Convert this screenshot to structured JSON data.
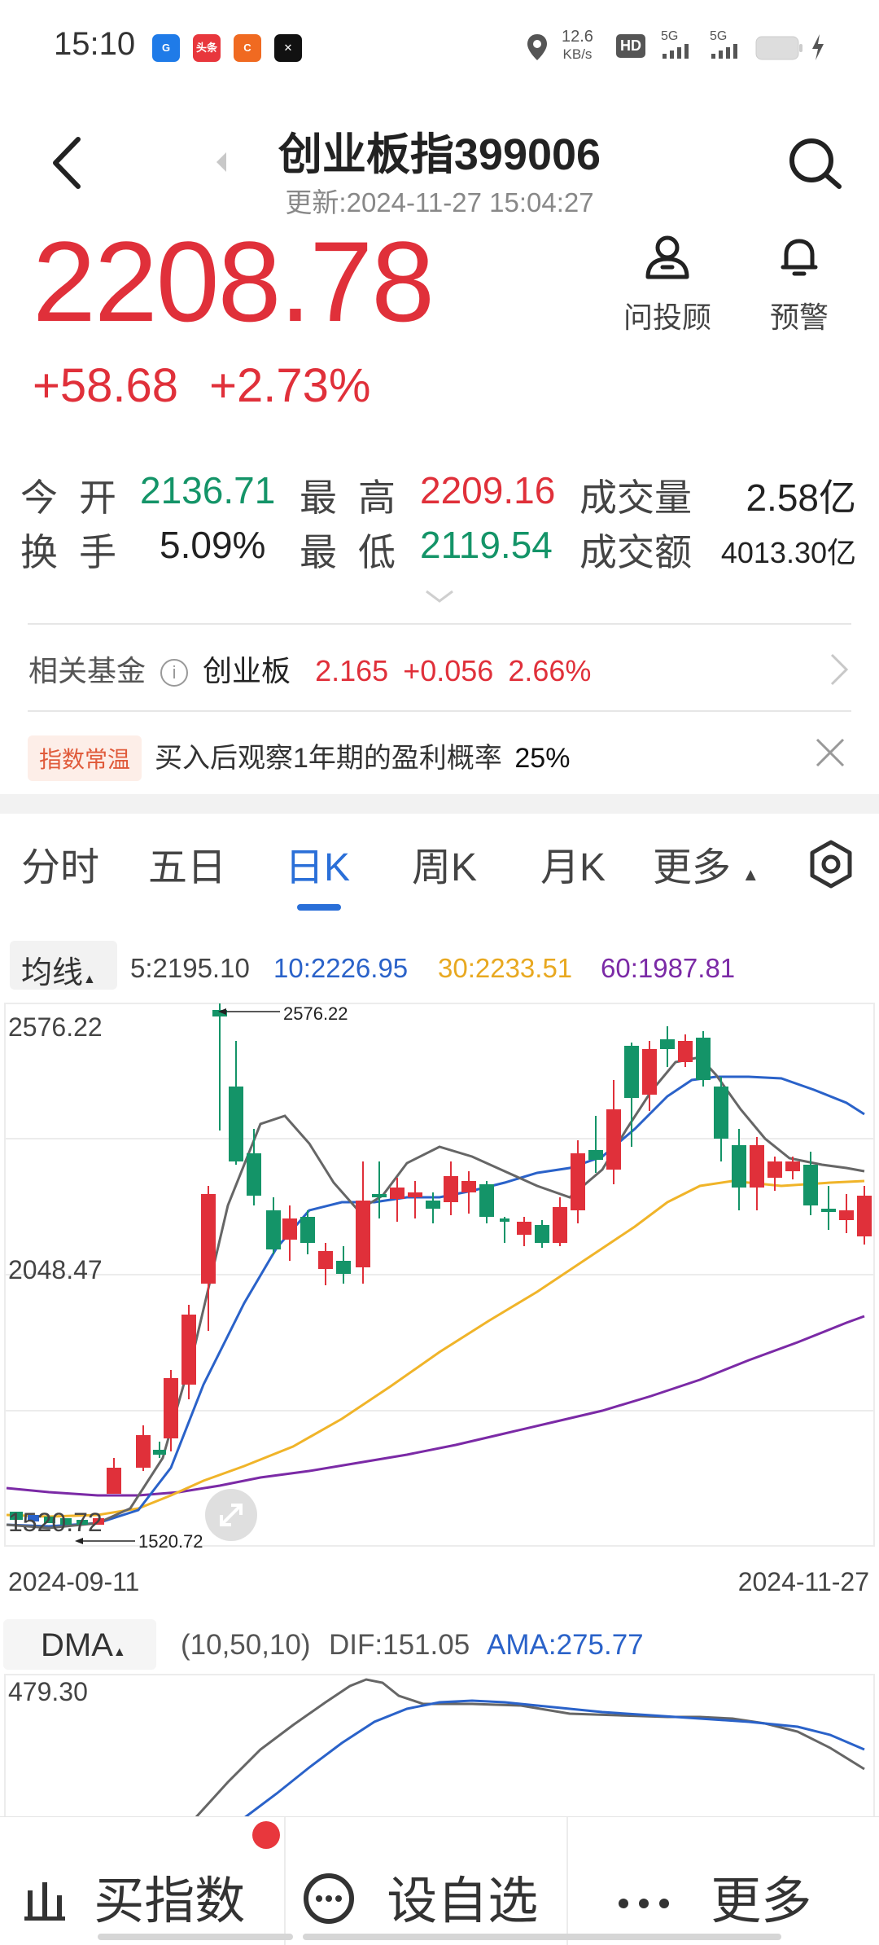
{
  "status_bar": {
    "time": "15:10",
    "net_speed_value": "12.6",
    "net_speed_unit": "KB/s",
    "hd_label": "HD",
    "sim1": "5G",
    "sim2": "5G",
    "icons": [
      "app-icon-blue",
      "app-icon-toutiao",
      "app-icon-orange",
      "app-icon-capcut",
      "location-icon",
      "signal-icon",
      "battery-icon",
      "charging-icon"
    ],
    "app_icon_toutiao_text": "头条"
  },
  "header": {
    "title": "创业板指399006",
    "updated": "更新:2024-11-27 15:04:27"
  },
  "quote": {
    "price": "2208.78",
    "change": "+58.68",
    "change_pct": "+2.73%",
    "advisor_label": "问投顾",
    "alert_label": "预警"
  },
  "stats": {
    "open_label": "今开",
    "open_value": "2136.71",
    "high_label": "最高",
    "high_value": "2209.16",
    "volume_label": "成交量",
    "volume_value": "2.58亿",
    "turnover_label": "换手",
    "turnover_value": "5.09%",
    "low_label": "最低",
    "low_value": "2119.54",
    "amount_label": "成交额",
    "amount_value": "4013.30亿"
  },
  "fund": {
    "label": "相关基金",
    "name": "创业板",
    "price": "2.165",
    "change": "+0.056",
    "change_pct": "2.66%"
  },
  "temperature": {
    "badge": "指数常温",
    "text": "买入后观察1年期的盈利概率",
    "value": "25%"
  },
  "tabs": [
    {
      "label": "分时"
    },
    {
      "label": "五日"
    },
    {
      "label": "日K"
    },
    {
      "label": "周K"
    },
    {
      "label": "月K"
    },
    {
      "label": "更多"
    }
  ],
  "ma_legend": {
    "button": "均线",
    "ma5": "5:2195.10",
    "ma10": "10:2226.95",
    "ma30": "30:2233.51",
    "ma60": "60:1987.81"
  },
  "chart": {
    "y_top": "2576.22",
    "y_mid": "2048.47",
    "y_low": "1520.72",
    "max_marker": "2576.22",
    "min_marker": "1520.72",
    "x_start": "2024-09-11",
    "x_end": "2024-11-27",
    "colors": {
      "up": "#e0303a",
      "down": "#149468",
      "ma5": "#666666",
      "ma10": "#2a62c9",
      "ma30": "#f0b429",
      "ma60": "#7b2aa6"
    }
  },
  "dma": {
    "button": "DMA",
    "params": "(10,50,10)",
    "dif": "DIF:151.05",
    "ama": "AMA:275.77",
    "y_top": "479.30"
  },
  "bottom_bar": {
    "buy_label": "买指数",
    "watch_label": "设自选",
    "more_label": "更多"
  }
}
